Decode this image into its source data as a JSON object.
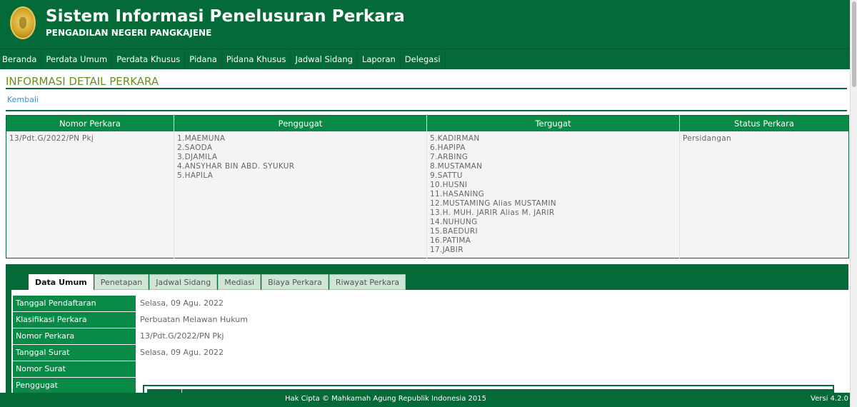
{
  "header": {
    "title": "Sistem Informasi Penelusuran Perkara",
    "subtitle": "PENGADILAN NEGERI PANGKAJENE"
  },
  "nav": [
    "Beranda",
    "Perdata Umum",
    "Perdata Khusus",
    "Pidana",
    "Pidana Khusus",
    "Jadwal Sidang",
    "Laporan",
    "Delegasi"
  ],
  "page": {
    "title": "INFORMASI DETAIL PERKARA",
    "back_label": "Kembali"
  },
  "case_table": {
    "headers": [
      "Nomor Perkara",
      "Penggugat",
      "Tergugat",
      "Status Perkara"
    ],
    "nomor": "13/Pdt.G/2022/PN Pkj",
    "penggugat": [
      "1.MAEMUNA",
      "2.SAODA",
      "3.DJAMILA",
      "4.ANSYHAR BIN ABD. SYUKUR",
      "5.HAPILA"
    ],
    "tergugat": [
      "5.KADIRMAN",
      "6.HAPIPA",
      "7.ARBING",
      "8.MUSTAMAN",
      "9.SATTU",
      "10.HUSNI",
      "11.HASANING",
      "12.MUSTAMING Alias MUSTAMIN",
      "13.H. MUH. JARIR Alias M. JARIR",
      "14.NUHUNG",
      "15.BAEDURI",
      "16.PATIMA",
      "17.JABIR"
    ],
    "status": "Persidangan"
  },
  "tabs": [
    "Data Umum",
    "Penetapan",
    "Jadwal Sidang",
    "Mediasi",
    "Biaya Perkara",
    "Riwayat Perkara"
  ],
  "fields": [
    {
      "label": "Tanggal Pendaftaran",
      "value": "Selasa, 09 Agu. 2022"
    },
    {
      "label": "Klasifikasi Perkara",
      "value": "Perbuatan Melawan Hukum"
    },
    {
      "label": "Nomor Perkara",
      "value": "13/Pdt.G/2022/PN Pkj"
    },
    {
      "label": "Tanggal Surat",
      "value": "Selasa, 09 Agu. 2022"
    },
    {
      "label": "Nomor Surat",
      "value": ""
    },
    {
      "label": "Penggugat",
      "value": ""
    }
  ],
  "footer": {
    "copyright": "Hak Cipta © Mahkamah Agung Republik Indonesia 2015",
    "version": "Versi 4.2.0"
  },
  "colors": {
    "primary": "#046a38",
    "accent": "#0a8a47",
    "title": "#6b8e1f",
    "link": "#3b8fd1"
  }
}
